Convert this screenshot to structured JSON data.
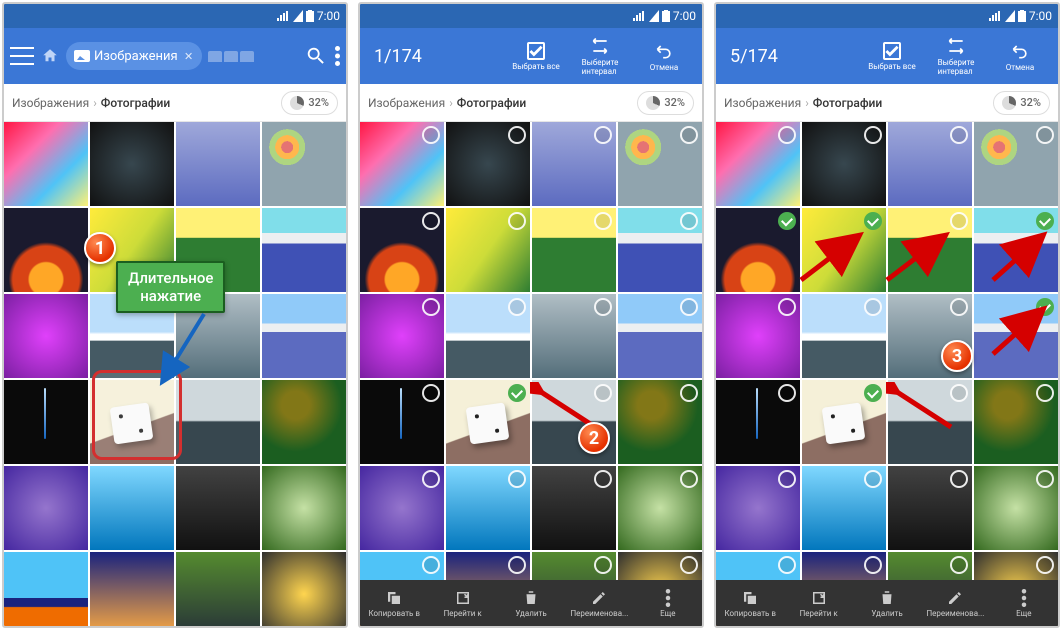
{
  "status": {
    "time": "7:00"
  },
  "screen1": {
    "chip_label": "Изображения",
    "breadcrumb": {
      "root": "Изображения",
      "current": "Фотографии"
    },
    "storage": "32%",
    "tooltip": "Длительное\nнажатие",
    "badge": "1"
  },
  "screen2": {
    "count": "1/174",
    "actions": {
      "select_all": "Выбрать все",
      "interval": "Выберите\nинтервал",
      "cancel": "Отмена"
    },
    "breadcrumb": {
      "root": "Изображения",
      "current": "Фотографии"
    },
    "storage": "32%",
    "badge": "2",
    "bottom": {
      "copy": "Копировать в",
      "goto": "Перейти к",
      "delete": "Удалить",
      "rename": "Переименова...",
      "more": "Еще"
    }
  },
  "screen3": {
    "count": "5/174",
    "actions": {
      "select_all": "Выбрать все",
      "interval": "Выберите\nинтервал",
      "cancel": "Отмена"
    },
    "breadcrumb": {
      "root": "Изображения",
      "current": "Фотографии"
    },
    "storage": "32%",
    "badge": "3",
    "bottom": {
      "copy": "Копировать в",
      "goto": "Перейти к",
      "delete": "Удалить",
      "rename": "Переименова...",
      "more": "Еще"
    }
  },
  "grid": {
    "rows": 6,
    "cols": 4,
    "screen2_selected": [
      13
    ],
    "screen3_selected": [
      4,
      5,
      7,
      11,
      13
    ]
  }
}
